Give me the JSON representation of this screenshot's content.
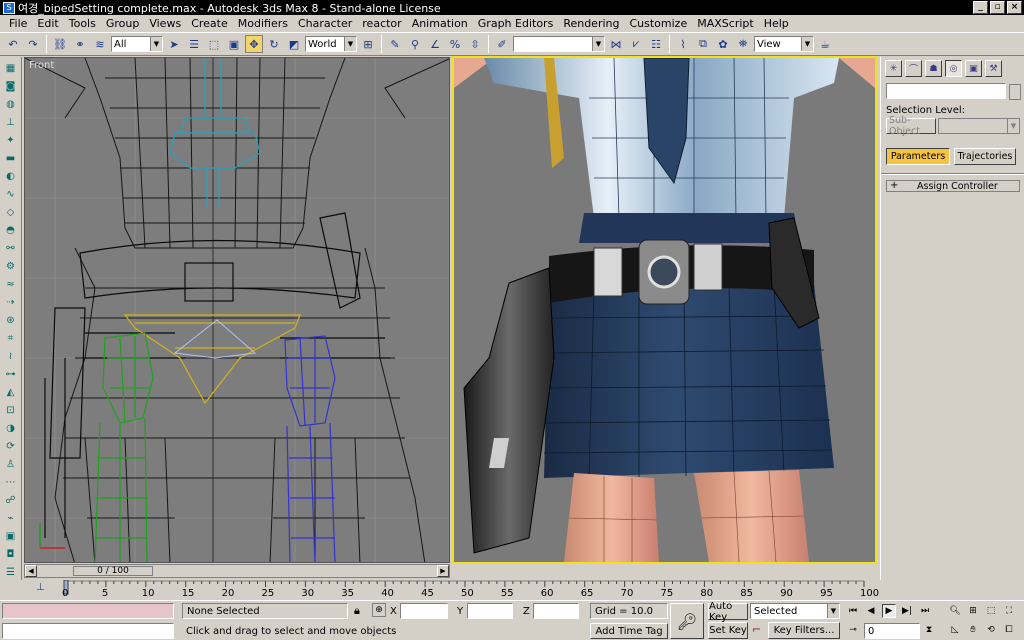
{
  "title_bar": {
    "app_icon": "3ds-max-icon",
    "title": "여경_bipedSetting complete.max - Autodesk 3ds Max 8 - Stand-alone License",
    "minimize": "_",
    "maximize": "▫",
    "close": "×"
  },
  "menu": [
    "File",
    "Edit",
    "Tools",
    "Group",
    "Views",
    "Create",
    "Modifiers",
    "Character",
    "reactor",
    "Animation",
    "Graph Editors",
    "Rendering",
    "Customize",
    "MAXScript",
    "Help"
  ],
  "toolbar": {
    "selection_filter": "All",
    "reference_coord": "World",
    "named_selection": "",
    "view_dropdown": "View"
  },
  "viewports": {
    "left_label": "Front",
    "scroll_label": "0 / 100",
    "active_color": "#f0e020"
  },
  "command_panel": {
    "name_field": "",
    "selection_level_label": "Selection Level:",
    "sub_object_button": "Sub-Object",
    "tab_parameters": "Parameters",
    "tab_trajectories": "Trajectories",
    "rollout_plus": "+",
    "rollout_assign_controller": "Assign Controller"
  },
  "trackbar": {
    "ticks": [
      "0",
      "5",
      "10",
      "15",
      "20",
      "25",
      "30",
      "35",
      "40",
      "45",
      "50",
      "55",
      "60",
      "65",
      "70",
      "75",
      "80",
      "85",
      "90",
      "95",
      "100"
    ],
    "current_frame": 0
  },
  "status_bar": {
    "selection_status": "None Selected",
    "prompt": "Click and drag to select and move objects",
    "x_label": "X",
    "y_label": "Y",
    "z_label": "Z",
    "grid": "Grid = 10.0",
    "add_time_tag": "Add Time Tag",
    "auto_key": "Auto Key",
    "set_key": "Set Key",
    "selected_dropdown": "Selected",
    "key_filters": "Key Filters...",
    "frame_field": "0"
  }
}
